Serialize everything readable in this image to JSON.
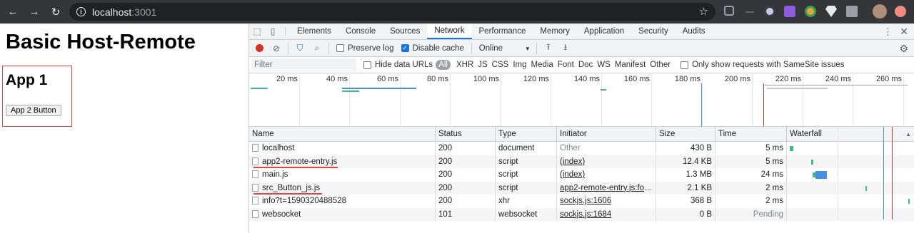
{
  "browser": {
    "url_host": "localhost",
    "url_port": ":3001"
  },
  "page": {
    "heading": "Basic Host-Remote",
    "app_title": "App 1",
    "app_button": "App 2 Button"
  },
  "devtools": {
    "tabs": [
      "Elements",
      "Console",
      "Sources",
      "Network",
      "Performance",
      "Memory",
      "Application",
      "Security",
      "Audits"
    ],
    "active_tab": "Network",
    "toolbar": {
      "preserve_log": "Preserve log",
      "disable_cache": "Disable cache",
      "throttling": "Online"
    },
    "filter": {
      "placeholder": "Filter",
      "hide_data_urls": "Hide data URLs",
      "types": [
        "All",
        "XHR",
        "JS",
        "CSS",
        "Img",
        "Media",
        "Font",
        "Doc",
        "WS",
        "Manifest",
        "Other"
      ],
      "samesite": "Only show requests with SameSite issues"
    },
    "overview_ticks": [
      "20 ms",
      "40 ms",
      "60 ms",
      "80 ms",
      "100 ms",
      "120 ms",
      "140 ms",
      "160 ms",
      "180 ms",
      "200 ms",
      "220 ms",
      "240 ms",
      "260 ms"
    ],
    "columns": [
      "Name",
      "Status",
      "Type",
      "Initiator",
      "Size",
      "Time",
      "Waterfall"
    ],
    "rows": [
      {
        "name": "localhost",
        "status": "200",
        "type": "document",
        "initiator": "Other",
        "size": "430 B",
        "time": "5 ms"
      },
      {
        "name": "app2-remote-entry.js",
        "status": "200",
        "type": "script",
        "initiator": "(index)",
        "size": "12.4 KB",
        "time": "5 ms"
      },
      {
        "name": "main.js",
        "status": "200",
        "type": "script",
        "initiator": "(index)",
        "size": "1.3 MB",
        "time": "24 ms"
      },
      {
        "name": "src_Button_js.js",
        "status": "200",
        "type": "script",
        "initiator": "app2-remote-entry.js:for...",
        "size": "2.1 KB",
        "time": "2 ms"
      },
      {
        "name": "info?t=1590320488528",
        "status": "200",
        "type": "xhr",
        "initiator": "sockjs.js:1606",
        "size": "368 B",
        "time": "2 ms"
      },
      {
        "name": "websocket",
        "status": "101",
        "type": "websocket",
        "initiator": "sockjs.js:1684",
        "size": "0 B",
        "time": "Pending"
      }
    ]
  },
  "colors": {
    "annotation_red": "#e0463f",
    "record_red": "#d93025",
    "accent_blue": "#1a73e8",
    "waterfall_green": "#3dbb8f",
    "waterfall_blue": "#4a90e2"
  }
}
